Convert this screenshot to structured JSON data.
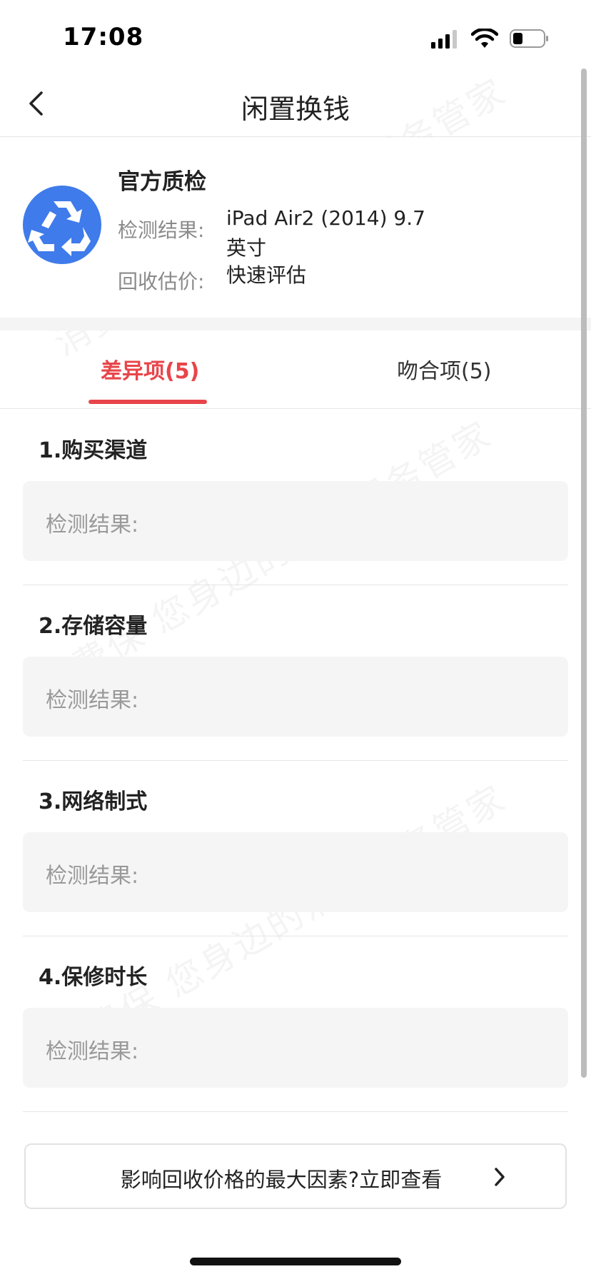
{
  "status": {
    "time": "17:08"
  },
  "nav": {
    "title": "闲置换钱"
  },
  "summary": {
    "title": "官方质检",
    "result_label": "检测结果:",
    "result_value": "iPad Air2 (2014) 9.7英寸",
    "price_label": "回收估价:",
    "price_value": "快速评估"
  },
  "tabs": [
    {
      "label": "差异项(5)",
      "active": true
    },
    {
      "label": "吻合项(5)",
      "active": false
    }
  ],
  "items": [
    {
      "title": "1.购买渠道",
      "result_label": "检测结果:"
    },
    {
      "title": "2.存储容量",
      "result_label": "检测结果:"
    },
    {
      "title": "3.网络制式",
      "result_label": "检测结果:"
    },
    {
      "title": "4.保修时长",
      "result_label": "检测结果:"
    }
  ],
  "factor_link": {
    "label": "影响回收价格的最大因素?立即查看"
  },
  "watermark": {
    "text": "消费保 您身边的消费服务管家"
  },
  "colors": {
    "accent": "#e8454a",
    "logo": "#3f7bea",
    "box_bg": "#f5f5f5"
  },
  "icons": [
    "signal-icon",
    "wifi-icon",
    "battery-icon",
    "back-arrow-icon",
    "recycle-icon",
    "chevron-right-icon"
  ]
}
